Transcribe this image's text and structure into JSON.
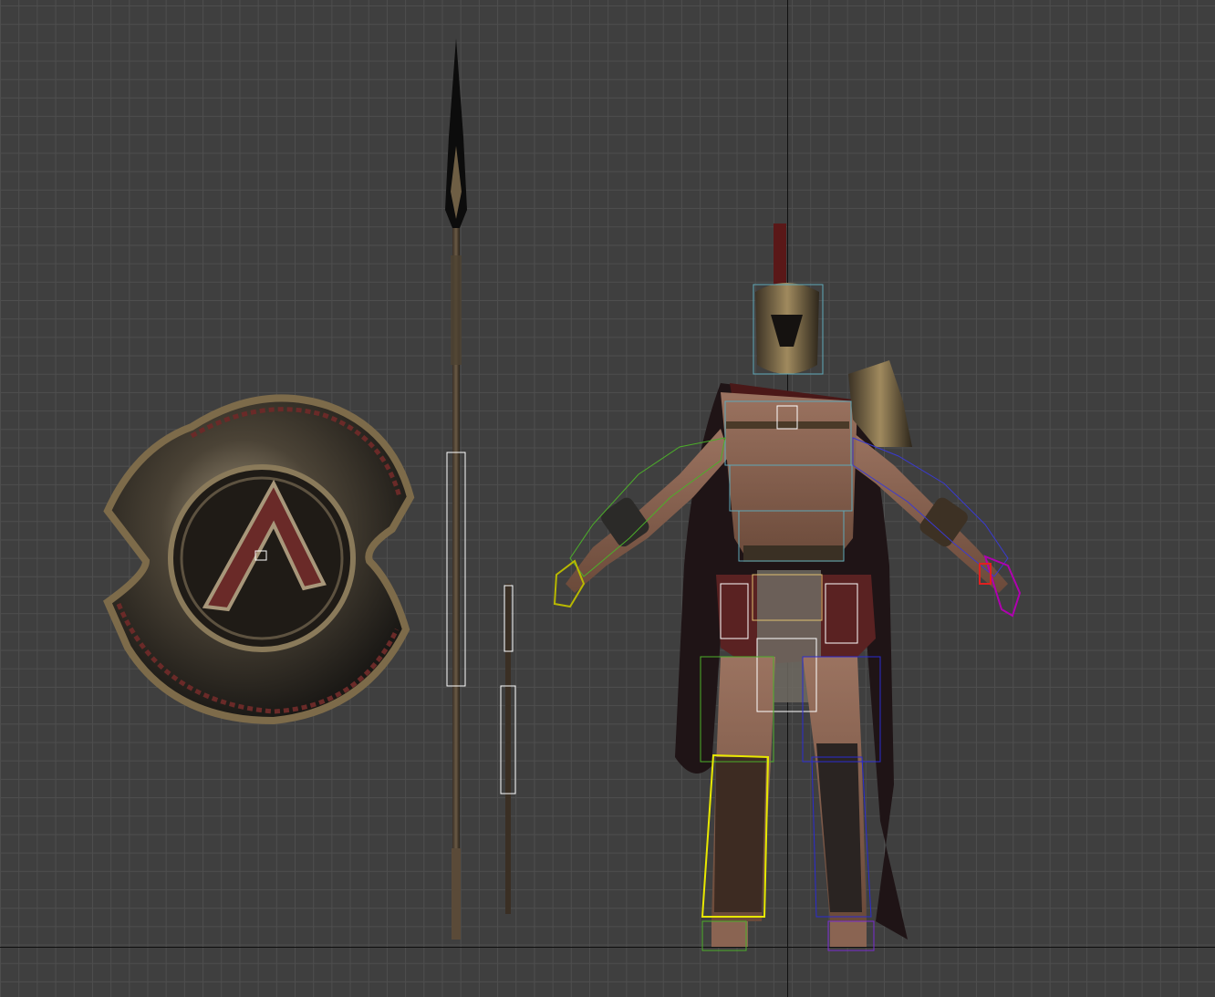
{
  "viewport": {
    "label": "",
    "background_color": "#3f3f3f",
    "grid_color": "#4e4e4e",
    "axis_color": "#111111"
  },
  "objects": {
    "shield": {
      "name": "shield",
      "icon": "shield-icon",
      "metal": "#6e6048",
      "emblem": "#6a2a28"
    },
    "spear": {
      "name": "spear",
      "icon": "spear-icon"
    },
    "short_spear": {
      "name": "spear-shaft",
      "icon": "spear-icon"
    },
    "warrior": {
      "name": "warrior",
      "icon": "warrior-icon",
      "cape": "#4a1818",
      "skin": "#8a6452"
    }
  },
  "bone_colors": {
    "spine": "#5fa8b8",
    "left_arm": "#4caf2a",
    "right_arm": "#3a3ad0",
    "left_leg": "#e8e800",
    "right_leg": "#2b2bd0",
    "skirt": "#ffffff",
    "left_hand": "#b8b800",
    "right_hand": "#b000b0"
  }
}
